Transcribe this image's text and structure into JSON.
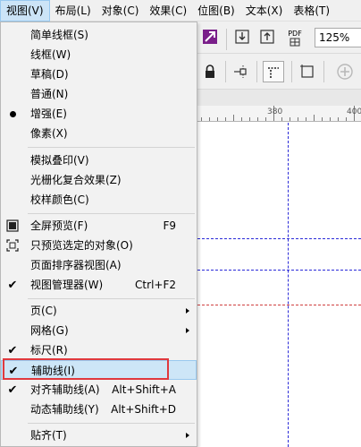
{
  "menubar": {
    "items": [
      "视图(V)",
      "布局(L)",
      "对象(C)",
      "效果(C)",
      "位图(B)",
      "文本(X)",
      "表格(T)"
    ]
  },
  "toolbar": {
    "zoom_value": "125%",
    "pdf_label": "PDF"
  },
  "ruler": {
    "labels": [
      "380",
      "400"
    ]
  },
  "view_menu": {
    "items": [
      {
        "label": "简单线框(S)",
        "mark": "none",
        "shortcut": "",
        "submenu": false
      },
      {
        "label": "线框(W)",
        "mark": "none",
        "shortcut": "",
        "submenu": false
      },
      {
        "label": "草稿(D)",
        "mark": "none",
        "shortcut": "",
        "submenu": false
      },
      {
        "label": "普通(N)",
        "mark": "none",
        "shortcut": "",
        "submenu": false
      },
      {
        "label": "增强(E)",
        "mark": "dot",
        "shortcut": "",
        "submenu": false
      },
      {
        "label": "像素(X)",
        "mark": "none",
        "shortcut": "",
        "submenu": false
      },
      {
        "label": "模拟叠印(V)",
        "mark": "none",
        "shortcut": "",
        "submenu": false
      },
      {
        "label": "光栅化复合效果(Z)",
        "mark": "none",
        "shortcut": "",
        "submenu": false
      },
      {
        "label": "校样颜色(C)",
        "mark": "none",
        "shortcut": "",
        "submenu": false
      },
      {
        "label": "全屏预览(F)",
        "mark": "fullscreen-icon",
        "shortcut": "F9",
        "submenu": false
      },
      {
        "label": "只预览选定的对象(O)",
        "mark": "preview-selected-icon",
        "shortcut": "",
        "submenu": false
      },
      {
        "label": "页面排序器视图(A)",
        "mark": "none",
        "shortcut": "",
        "submenu": false
      },
      {
        "label": "视图管理器(W)",
        "mark": "check",
        "shortcut": "Ctrl+F2",
        "submenu": false
      },
      {
        "label": "页(C)",
        "mark": "none",
        "shortcut": "",
        "submenu": true
      },
      {
        "label": "网格(G)",
        "mark": "none",
        "shortcut": "",
        "submenu": true
      },
      {
        "label": "标尺(R)",
        "mark": "check",
        "shortcut": "",
        "submenu": false
      },
      {
        "label": "辅助线(I)",
        "mark": "check",
        "shortcut": "",
        "submenu": false,
        "highlighted": true
      },
      {
        "label": "对齐辅助线(A)",
        "mark": "check",
        "shortcut": "Alt+Shift+A",
        "submenu": false
      },
      {
        "label": "动态辅助线(Y)",
        "mark": "none",
        "shortcut": "Alt+Shift+D",
        "submenu": false
      },
      {
        "label": "贴齐(T)",
        "mark": "none",
        "shortcut": "",
        "submenu": true
      }
    ]
  },
  "colors": {
    "highlight": "#cde6f7",
    "annotation_box": "#e0393e",
    "guide_blue": "#2a2ad8",
    "guide_red": "#d04040",
    "toolbar_icon_accent": "#7a1f8a"
  }
}
